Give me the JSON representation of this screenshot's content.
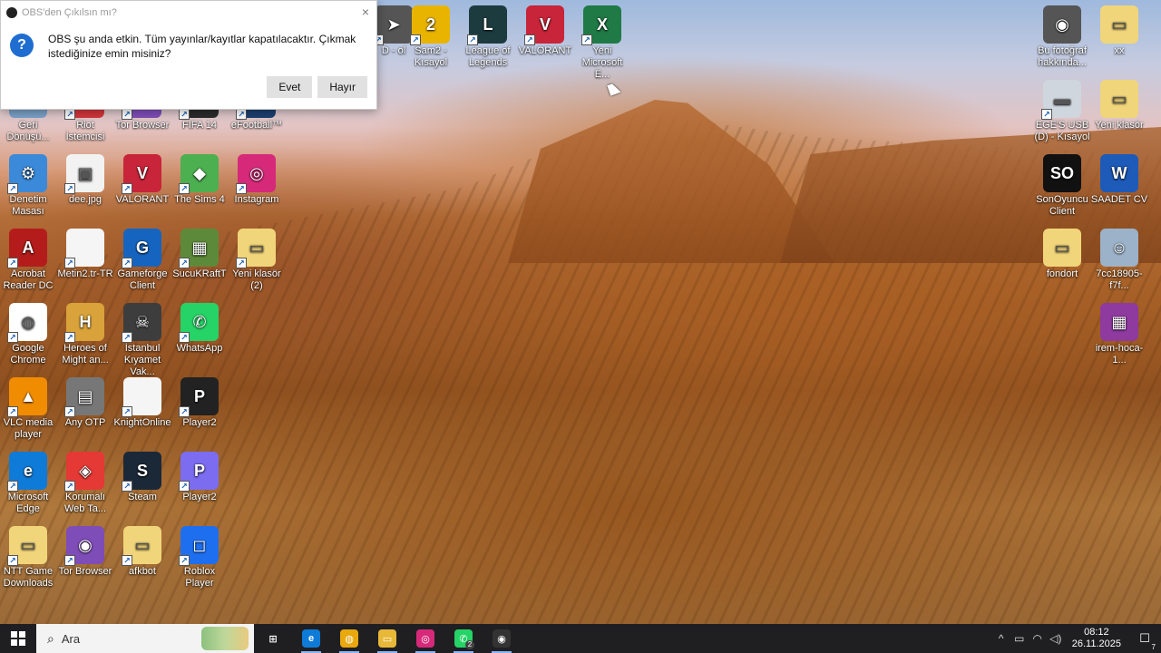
{
  "dialog": {
    "title": "OBS'den Çıkılsın mı?",
    "message": "OBS şu anda etkin. Tüm yayınlar/kayıtlar kapatılacaktır. Çıkmak istediğinize emin misiniz?",
    "yes_label": "Evet",
    "no_label": "Hayır",
    "close_glyph": "×",
    "question_glyph": "?"
  },
  "top_icons": [
    {
      "label": "D - ol",
      "icon": "partial-shortcut-icon",
      "color": "#555555",
      "glyph": "➤"
    },
    {
      "label": "Sam2 - Kısayol",
      "icon": "sam2-icon",
      "color": "#e8b400",
      "glyph": "2"
    },
    {
      "label": "League of Legends",
      "icon": "league-of-legends-icon",
      "color": "#1c3b3f",
      "glyph": "L"
    },
    {
      "label": "VALORANT",
      "icon": "valorant-icon",
      "color": "#c8243a",
      "glyph": "V"
    },
    {
      "label": "Yeni Microsoft E...",
      "icon": "excel-icon",
      "color": "#1f7a45",
      "glyph": "X"
    }
  ],
  "row2_partial": [
    {
      "label": "Geri Dönüşü...",
      "icon": "recycle-bin-icon",
      "color": "#7aa0c8",
      "glyph": "♻"
    },
    {
      "label": "Riot İstemcisi",
      "icon": "riot-client-icon",
      "color": "#d13639",
      "glyph": "R"
    },
    {
      "label": "Tor Browser",
      "icon": "tor-browser-icon",
      "color": "#7e4db7",
      "glyph": "◉"
    },
    {
      "label": "FIFA 14",
      "icon": "fifa-icon",
      "color": "#2b2b2b",
      "glyph": "F"
    },
    {
      "label": "eFootball™",
      "icon": "efootball-icon",
      "color": "#1b3f6f",
      "glyph": "e"
    }
  ],
  "left_icons": [
    [
      {
        "label": "Denetim Masası",
        "icon": "control-panel-icon",
        "color": "#3b8ad9",
        "glyph": "⚙"
      },
      {
        "label": "dee.jpg",
        "icon": "image-file-icon",
        "color": "#f2f2f2",
        "glyph": "▣"
      },
      {
        "label": "VALORANT",
        "icon": "valorant-icon",
        "color": "#c8243a",
        "glyph": "V"
      },
      {
        "label": "The Sims 4",
        "icon": "sims4-icon",
        "color": "#4caf50",
        "glyph": "◆"
      },
      {
        "label": "Instagram",
        "icon": "instagram-icon",
        "color": "#d6297a",
        "glyph": "◎"
      }
    ],
    [
      {
        "label": "Acrobat Reader DC",
        "icon": "acrobat-icon",
        "color": "#b41c1c",
        "glyph": "A"
      },
      {
        "label": "Metin2.tr-TR",
        "icon": "file-icon",
        "color": "#f5f5f5",
        "glyph": ""
      },
      {
        "label": "Gameforge Client",
        "icon": "gameforge-icon",
        "color": "#1565c0",
        "glyph": "G"
      },
      {
        "label": "SucuKRaftT",
        "icon": "minecraft-icon",
        "color": "#5d8a3a",
        "glyph": "▦"
      },
      {
        "label": "Yeni klasör (2)",
        "icon": "folder-icon",
        "color": "#f1d57a",
        "glyph": "▭"
      }
    ],
    [
      {
        "label": "Google Chrome",
        "icon": "chrome-icon",
        "color": "#ffffff",
        "glyph": "◍"
      },
      {
        "label": "Heroes of Might an...",
        "icon": "heroes-icon",
        "color": "#d9a23a",
        "glyph": "H"
      },
      {
        "label": "İstanbul Kıyamet Vak...",
        "icon": "istanbul-kiyamet-icon",
        "color": "#3d3d3d",
        "glyph": "☠"
      },
      {
        "label": "WhatsApp",
        "icon": "whatsapp-icon",
        "color": "#25d366",
        "glyph": "✆"
      }
    ],
    [
      {
        "label": "VLC media player",
        "icon": "vlc-icon",
        "color": "#f08c00",
        "glyph": "▲"
      },
      {
        "label": "Any OTP",
        "icon": "any-otp-icon",
        "color": "#777777",
        "glyph": "▤"
      },
      {
        "label": "KnightOnline",
        "icon": "file-icon",
        "color": "#f5f5f5",
        "glyph": ""
      },
      {
        "label": "Player2",
        "icon": "player2-icon",
        "color": "#222222",
        "glyph": "P"
      }
    ],
    [
      {
        "label": "Microsoft Edge",
        "icon": "edge-icon",
        "color": "#0f7bd8",
        "glyph": "e"
      },
      {
        "label": "Korumalı Web Ta...",
        "icon": "protected-web-icon",
        "color": "#e53935",
        "glyph": "◈"
      },
      {
        "label": "Steam",
        "icon": "steam-icon",
        "color": "#1b2838",
        "glyph": "S"
      },
      {
        "label": "Player2",
        "icon": "player2-icon",
        "color": "#7b6cf0",
        "glyph": "P"
      }
    ],
    [
      {
        "label": "NTT Game Downloads",
        "icon": "folder-icon",
        "color": "#f1d57a",
        "glyph": "▭"
      },
      {
        "label": "Tor Browser",
        "icon": "tor-browser-icon",
        "color": "#7e4db7",
        "glyph": "◉"
      },
      {
        "label": "afkbot",
        "icon": "zip-folder-icon",
        "color": "#f1d57a",
        "glyph": "▭"
      },
      {
        "label": "Roblox Player",
        "icon": "roblox-icon",
        "color": "#1e6ff0",
        "glyph": "◻"
      }
    ]
  ],
  "right_icons": [
    [
      {
        "label": "Bu fotoğraf hakkında...",
        "icon": "camera-icon",
        "color": "#555555",
        "glyph": "◉"
      },
      {
        "label": "xx",
        "icon": "folder-icon",
        "color": "#f1d57a",
        "glyph": "▭"
      }
    ],
    [
      {
        "label": "EGE'S USB (D) - Kısayol",
        "icon": "usb-drive-icon",
        "color": "#cfd6de",
        "glyph": "▬"
      },
      {
        "label": "Yeni klasör",
        "icon": "folder-icon",
        "color": "#f1d57a",
        "glyph": "▭"
      }
    ],
    [
      {
        "label": "SonOyuncu Client",
        "icon": "sonoyuncu-icon",
        "color": "#111111",
        "glyph": "SO"
      },
      {
        "label": "SAADET CV",
        "icon": "word-icon",
        "color": "#1e5ab8",
        "glyph": "W"
      }
    ],
    [
      {
        "label": "fondort",
        "icon": "folder-icon",
        "color": "#f1d57a",
        "glyph": "▭"
      },
      {
        "label": "7cc18905-f7f...",
        "icon": "photo-file-icon",
        "color": "#9bb2c8",
        "glyph": "☺"
      }
    ],
    [
      {
        "label": "irem-hoca-1...",
        "icon": "winrar-icon",
        "color": "#8e3a9f",
        "glyph": "▦"
      }
    ]
  ],
  "taskbar": {
    "search_placeholder": "Ara",
    "search_glyph": "⌕",
    "apps": [
      {
        "name": "task-view-icon",
        "color": "#1f1f22",
        "glyph": "⊞"
      },
      {
        "name": "edge-icon",
        "color": "#0f7bd8",
        "glyph": "e"
      },
      {
        "name": "chrome-icon",
        "color": "#e8a80e",
        "glyph": "◍"
      },
      {
        "name": "file-explorer-icon",
        "color": "#e8b838",
        "glyph": "▭"
      },
      {
        "name": "instagram-icon",
        "color": "#d6297a",
        "glyph": "◎"
      },
      {
        "name": "whatsapp-icon",
        "color": "#25d366",
        "glyph": "✆",
        "badge": "2"
      },
      {
        "name": "obs-icon",
        "color": "#333333",
        "glyph": "◉"
      }
    ],
    "tray": {
      "chevron": "^",
      "battery": "▭",
      "network": "◠",
      "volume": "◁)",
      "time": "08:12",
      "date": "26.11.2025",
      "notification_count": "7",
      "notification_glyph": "☐"
    }
  }
}
